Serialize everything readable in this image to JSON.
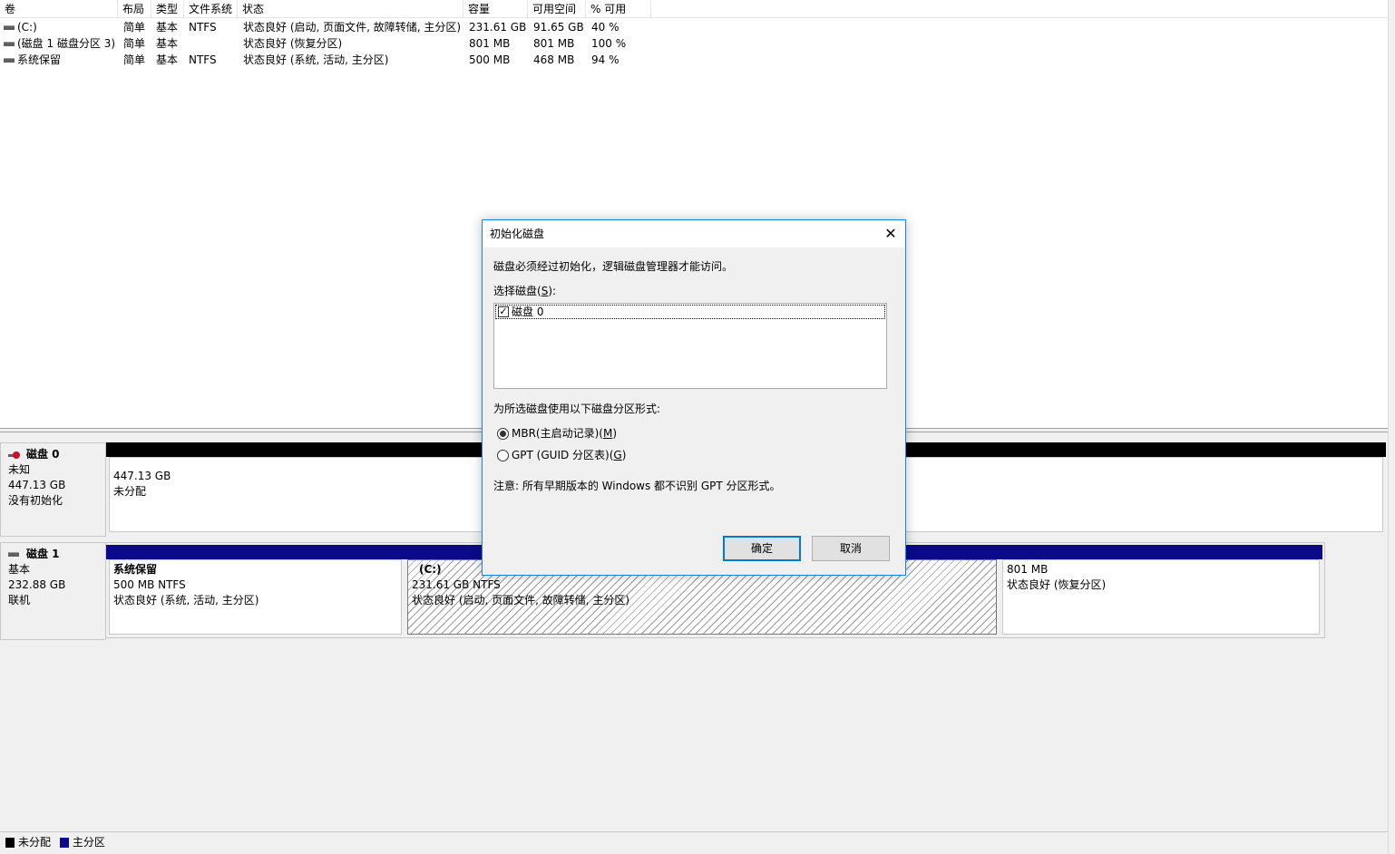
{
  "volume_list": {
    "columns": [
      "卷",
      "布局",
      "类型",
      "文件系统",
      "状态",
      "容量",
      "可用空间",
      "% 可用"
    ],
    "rows": [
      {
        "volume": "(C:)",
        "layout": "简单",
        "type": "基本",
        "fs": "NTFS",
        "status": "状态良好 (启动, 页面文件, 故障转储, 主分区)",
        "capacity": "231.61 GB",
        "free": "91.65 GB",
        "pct": "40 %"
      },
      {
        "volume": "(磁盘 1 磁盘分区 3)",
        "layout": "简单",
        "type": "基本",
        "fs": "",
        "status": "状态良好 (恢复分区)",
        "capacity": "801 MB",
        "free": "801 MB",
        "pct": "100 %"
      },
      {
        "volume": "系统保留",
        "layout": "简单",
        "type": "基本",
        "fs": "NTFS",
        "status": "状态良好 (系统, 活动, 主分区)",
        "capacity": "500 MB",
        "free": "468 MB",
        "pct": "94 %"
      }
    ]
  },
  "disks": {
    "disk0": {
      "name": "磁盘 0",
      "kind": "未知",
      "size": "447.13 GB",
      "state": "没有初始化",
      "partition": {
        "size": "447.13 GB",
        "label": "未分配"
      }
    },
    "disk1": {
      "name": "磁盘 1",
      "kind": "基本",
      "size": "232.88 GB",
      "state": "联机",
      "partitions": [
        {
          "title": "系统保留",
          "detail": "500 MB NTFS",
          "status": "状态良好 (系统, 活动, 主分区)"
        },
        {
          "title": "(C:)",
          "detail": "231.61 GB NTFS",
          "status": "状态良好 (启动, 页面文件, 故障转储, 主分区)"
        },
        {
          "title": "",
          "detail": "801 MB",
          "status": "状态良好 (恢复分区)"
        }
      ]
    }
  },
  "legend": {
    "unallocated": "未分配",
    "primary": "主分区"
  },
  "dialog": {
    "title": "初始化磁盘",
    "close_glyph": "✕",
    "intro": "磁盘必须经过初始化，逻辑磁盘管理器才能访问。",
    "select_label": "选择磁盘",
    "select_hotkey": "S",
    "disk_item": "磁盘 0",
    "disk_checked": true,
    "style_label": "为所选磁盘使用以下磁盘分区形式:",
    "mbr_label": "MBR(主启动记录)",
    "mbr_hotkey": "M",
    "gpt_label": "GPT (GUID 分区表)",
    "gpt_hotkey": "G",
    "selected_style": "MBR",
    "note": "注意: 所有早期版本的 Windows 都不识别 GPT 分区形式。",
    "ok_label": "确定",
    "cancel_label": "取消"
  },
  "colors": {
    "unallocated": "#000000",
    "primary": "#0a0a8a",
    "dialog_border": "#1883d7"
  }
}
